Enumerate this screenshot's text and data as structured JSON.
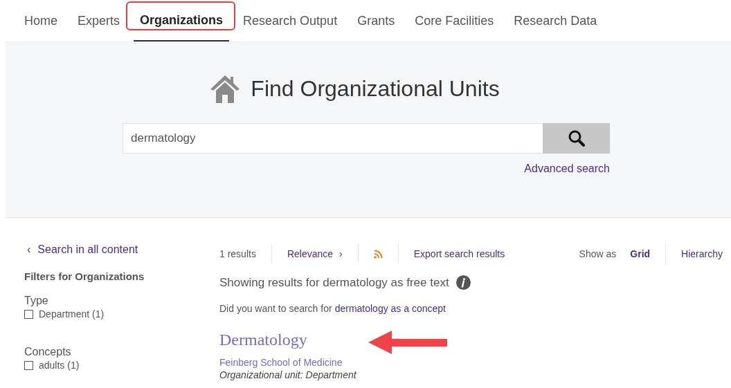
{
  "nav": {
    "tabs": [
      {
        "label": "Home",
        "selected": false,
        "highlighted": false
      },
      {
        "label": "Experts",
        "selected": false,
        "highlighted": false
      },
      {
        "label": "Organizations",
        "selected": true,
        "highlighted": true
      },
      {
        "label": "Research Output",
        "selected": false,
        "highlighted": false
      },
      {
        "label": "Grants",
        "selected": false,
        "highlighted": false
      },
      {
        "label": "Core Facilities",
        "selected": false,
        "highlighted": false
      },
      {
        "label": "Research Data",
        "selected": false,
        "highlighted": false
      }
    ]
  },
  "hero": {
    "title": "Find Organizational Units",
    "search": {
      "value": "dermatology"
    },
    "advanced_link": "Advanced search"
  },
  "sidebar": {
    "back_link": "Search in all content",
    "back_icon": "‹",
    "filters_title": "Filters for Organizations",
    "groups": [
      {
        "title": "Type",
        "options": [
          {
            "label": "Department (1)",
            "checked": false
          }
        ]
      },
      {
        "title": "Concepts",
        "options": [
          {
            "label": "adults (1)",
            "checked": false
          }
        ]
      }
    ]
  },
  "toolbar": {
    "count": "1 results",
    "sort": "Relevance",
    "sort_icon": "›",
    "export": "Export search results",
    "show_as": "Show as",
    "views": [
      {
        "label": "Grid",
        "selected": true
      },
      {
        "label": "Hierarchy",
        "selected": false
      }
    ]
  },
  "results": {
    "showing": "Showing results for dermatology as free text",
    "suggest_prefix": "Did you want to search for",
    "suggest_link": "dermatology as a concept",
    "items": [
      {
        "title": "Dermatology",
        "parent": "Feinberg School of Medicine",
        "type": "Organizational unit: Department",
        "pointed": true
      }
    ]
  }
}
